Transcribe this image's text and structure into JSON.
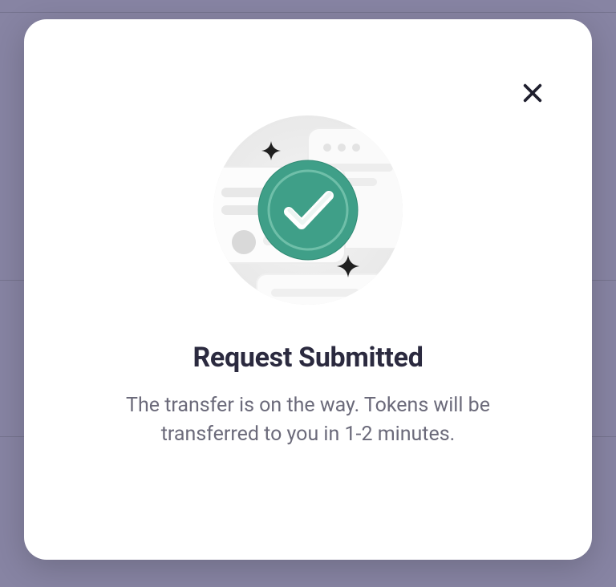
{
  "modal": {
    "title": "Request Submitted",
    "body": "The transfer is on the way. Tokens will be transferred to you in 1-2 minutes.",
    "close_icon": "close-icon",
    "illustration": "success-checkmark"
  },
  "colors": {
    "accent": "#3f9f88",
    "accent_inner": "#46aa92",
    "text_heading": "#2b2a3f",
    "text_body": "#6b6a7a",
    "modal_bg": "#ffffff",
    "backdrop": "#8784a3",
    "sparkle": "#1f1f1f"
  }
}
